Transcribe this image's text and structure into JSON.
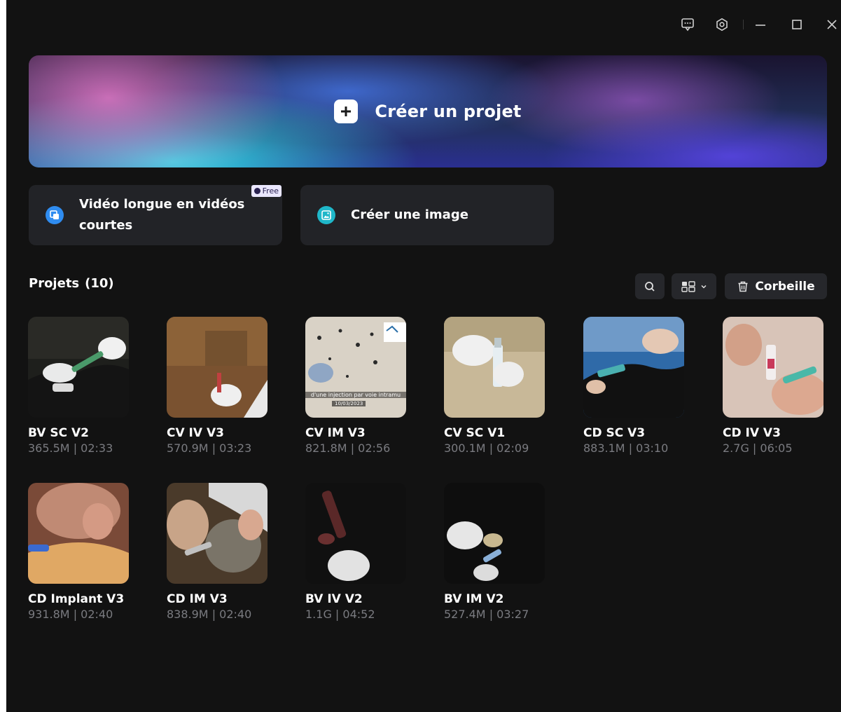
{
  "titlebar": {
    "icons": [
      "feedback-icon",
      "settings-icon",
      "minimize-icon",
      "maximize-icon",
      "close-icon"
    ]
  },
  "hero": {
    "label": "Créer un projet"
  },
  "features": [
    {
      "label": "Vidéo longue en vidéos courtes",
      "badge": "Free",
      "icon_color": "#2f8cf0"
    },
    {
      "label": "Créer une image",
      "icon_color": "#1fb7c9"
    }
  ],
  "projects": {
    "title": "Projets",
    "count": "(10)",
    "trash_label": "Corbeille",
    "items": [
      {
        "name": "BV SC V2",
        "meta": "365.5M | 02:33"
      },
      {
        "name": "CV IV V3",
        "meta": "570.9M | 03:23"
      },
      {
        "name": "CV IM V3",
        "meta": "821.8M | 02:56",
        "thumb_text": "d'une injection par voie intramu",
        "thumb_date": "10/03/2023"
      },
      {
        "name": "CV SC V1",
        "meta": "300.1M | 02:09"
      },
      {
        "name": "CD SC V3",
        "meta": "883.1M | 03:10"
      },
      {
        "name": "CD IV V3",
        "meta": "2.7G | 06:05"
      },
      {
        "name": "CD Implant V3",
        "meta": "931.8M | 02:40"
      },
      {
        "name": "CD IM V3",
        "meta": "838.9M | 02:40"
      },
      {
        "name": "BV IV V2",
        "meta": "1.1G | 04:52"
      },
      {
        "name": "BV IM V2",
        "meta": "527.4M | 03:27"
      }
    ]
  },
  "colors": {
    "background": "#121212",
    "card": "#222327",
    "button": "#26272b",
    "meta_text": "#7a7b80"
  }
}
